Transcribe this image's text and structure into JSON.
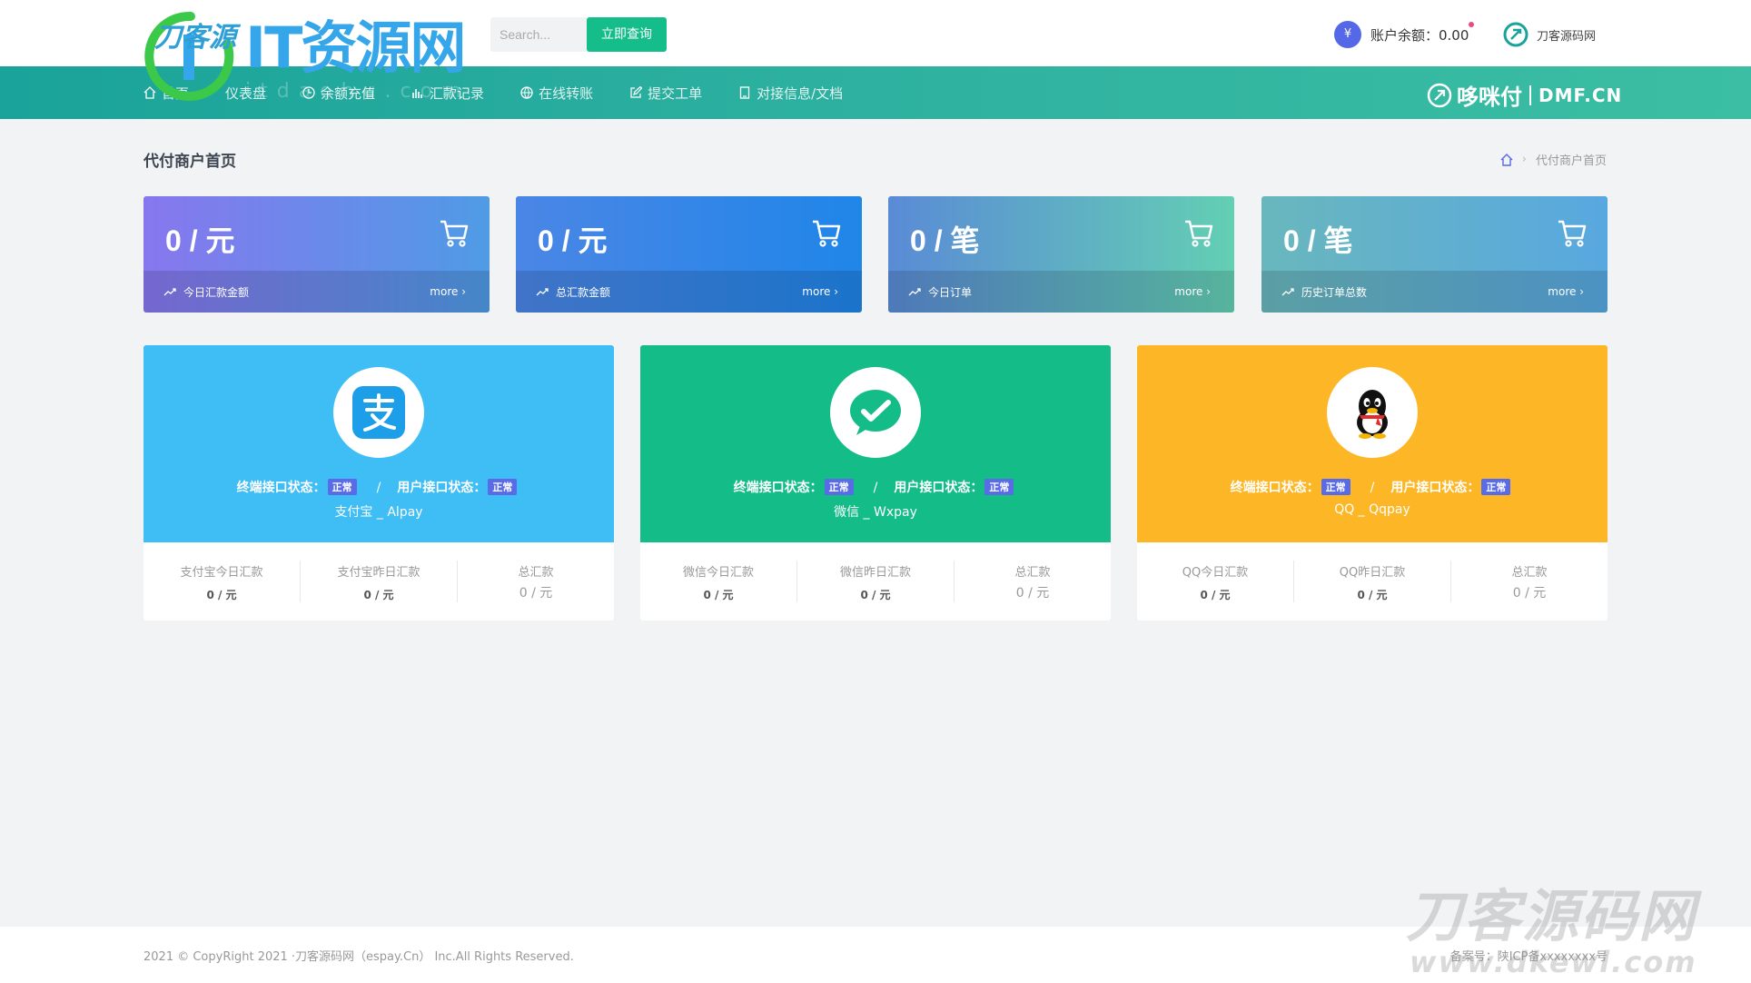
{
  "header": {
    "logo_text": "IT资源网",
    "logo_script": "刀客源",
    "logo_sub": "itdaohu.com",
    "search_placeholder": "Search...",
    "search_button": "立即查询",
    "balance_label": "账户余额：0.00",
    "site_name": "刀客源码网"
  },
  "nav": {
    "items": [
      {
        "label": "首页",
        "icon": "home-icon"
      },
      {
        "label": "仪表盘",
        "icon": "dashboard-icon"
      },
      {
        "label": "余额充值",
        "icon": "clock-icon"
      },
      {
        "label": "汇款记录",
        "icon": "bar-chart-icon"
      },
      {
        "label": "在线转账",
        "icon": "globe-icon"
      },
      {
        "label": "提交工单",
        "icon": "edit-icon"
      },
      {
        "label": "对接信息/文档",
        "icon": "document-icon"
      }
    ],
    "brand_name": "哆咪付",
    "brand_domain": "DMF.CN"
  },
  "page": {
    "title": "代付商户首页",
    "breadcrumb": "代付商户首页"
  },
  "stats": [
    {
      "value": "0 / 元",
      "label": "今日汇款金额",
      "more": "more"
    },
    {
      "value": "0 / 元",
      "label": "总汇款金额",
      "more": "more"
    },
    {
      "value": "0 / 笔",
      "label": "今日订单",
      "more": "more"
    },
    {
      "value": "0 / 笔",
      "label": "历史订单总数",
      "more": "more"
    }
  ],
  "pay_cards": [
    {
      "terminal_label": "终端接口状态：",
      "terminal_status": "正常",
      "user_label": "用户接口状态：",
      "user_status": "正常",
      "name": "支付宝 _ Alpay",
      "cols": [
        {
          "label": "支付宝今日汇款",
          "value": "0 / 元"
        },
        {
          "label": "支付宝昨日汇款",
          "value": "0 / 元"
        },
        {
          "label": "总汇款",
          "value": "0 / 元"
        }
      ],
      "color": "#3fbef6"
    },
    {
      "terminal_label": "终端接口状态：",
      "terminal_status": "正常",
      "user_label": "用户接口状态：",
      "user_status": "正常",
      "name": "微信 _ Wxpay",
      "cols": [
        {
          "label": "微信今日汇款",
          "value": "0 / 元"
        },
        {
          "label": "微信昨日汇款",
          "value": "0 / 元"
        },
        {
          "label": "总汇款",
          "value": "0 / 元"
        }
      ],
      "color": "#14bd87"
    },
    {
      "terminal_label": "终端接口状态：",
      "terminal_status": "正常",
      "user_label": "用户接口状态：",
      "user_status": "正常",
      "name": "QQ _ Qqpay",
      "cols": [
        {
          "label": "QQ今日汇款",
          "value": "0 / 元"
        },
        {
          "label": "QQ昨日汇款",
          "value": "0 / 元"
        },
        {
          "label": "总汇款",
          "value": "0 / 元"
        }
      ],
      "color": "#fdb726"
    }
  ],
  "footer": {
    "copyright": "2021 © CopyRight 2021 ·刀客源码网（espay.Cn） Inc.All Rights Reserved.",
    "icp": "备案号：陕ICP备xxxxxxxx号"
  },
  "watermark": {
    "line1": "刀客源码网",
    "line2": "www.dkewl.com"
  }
}
